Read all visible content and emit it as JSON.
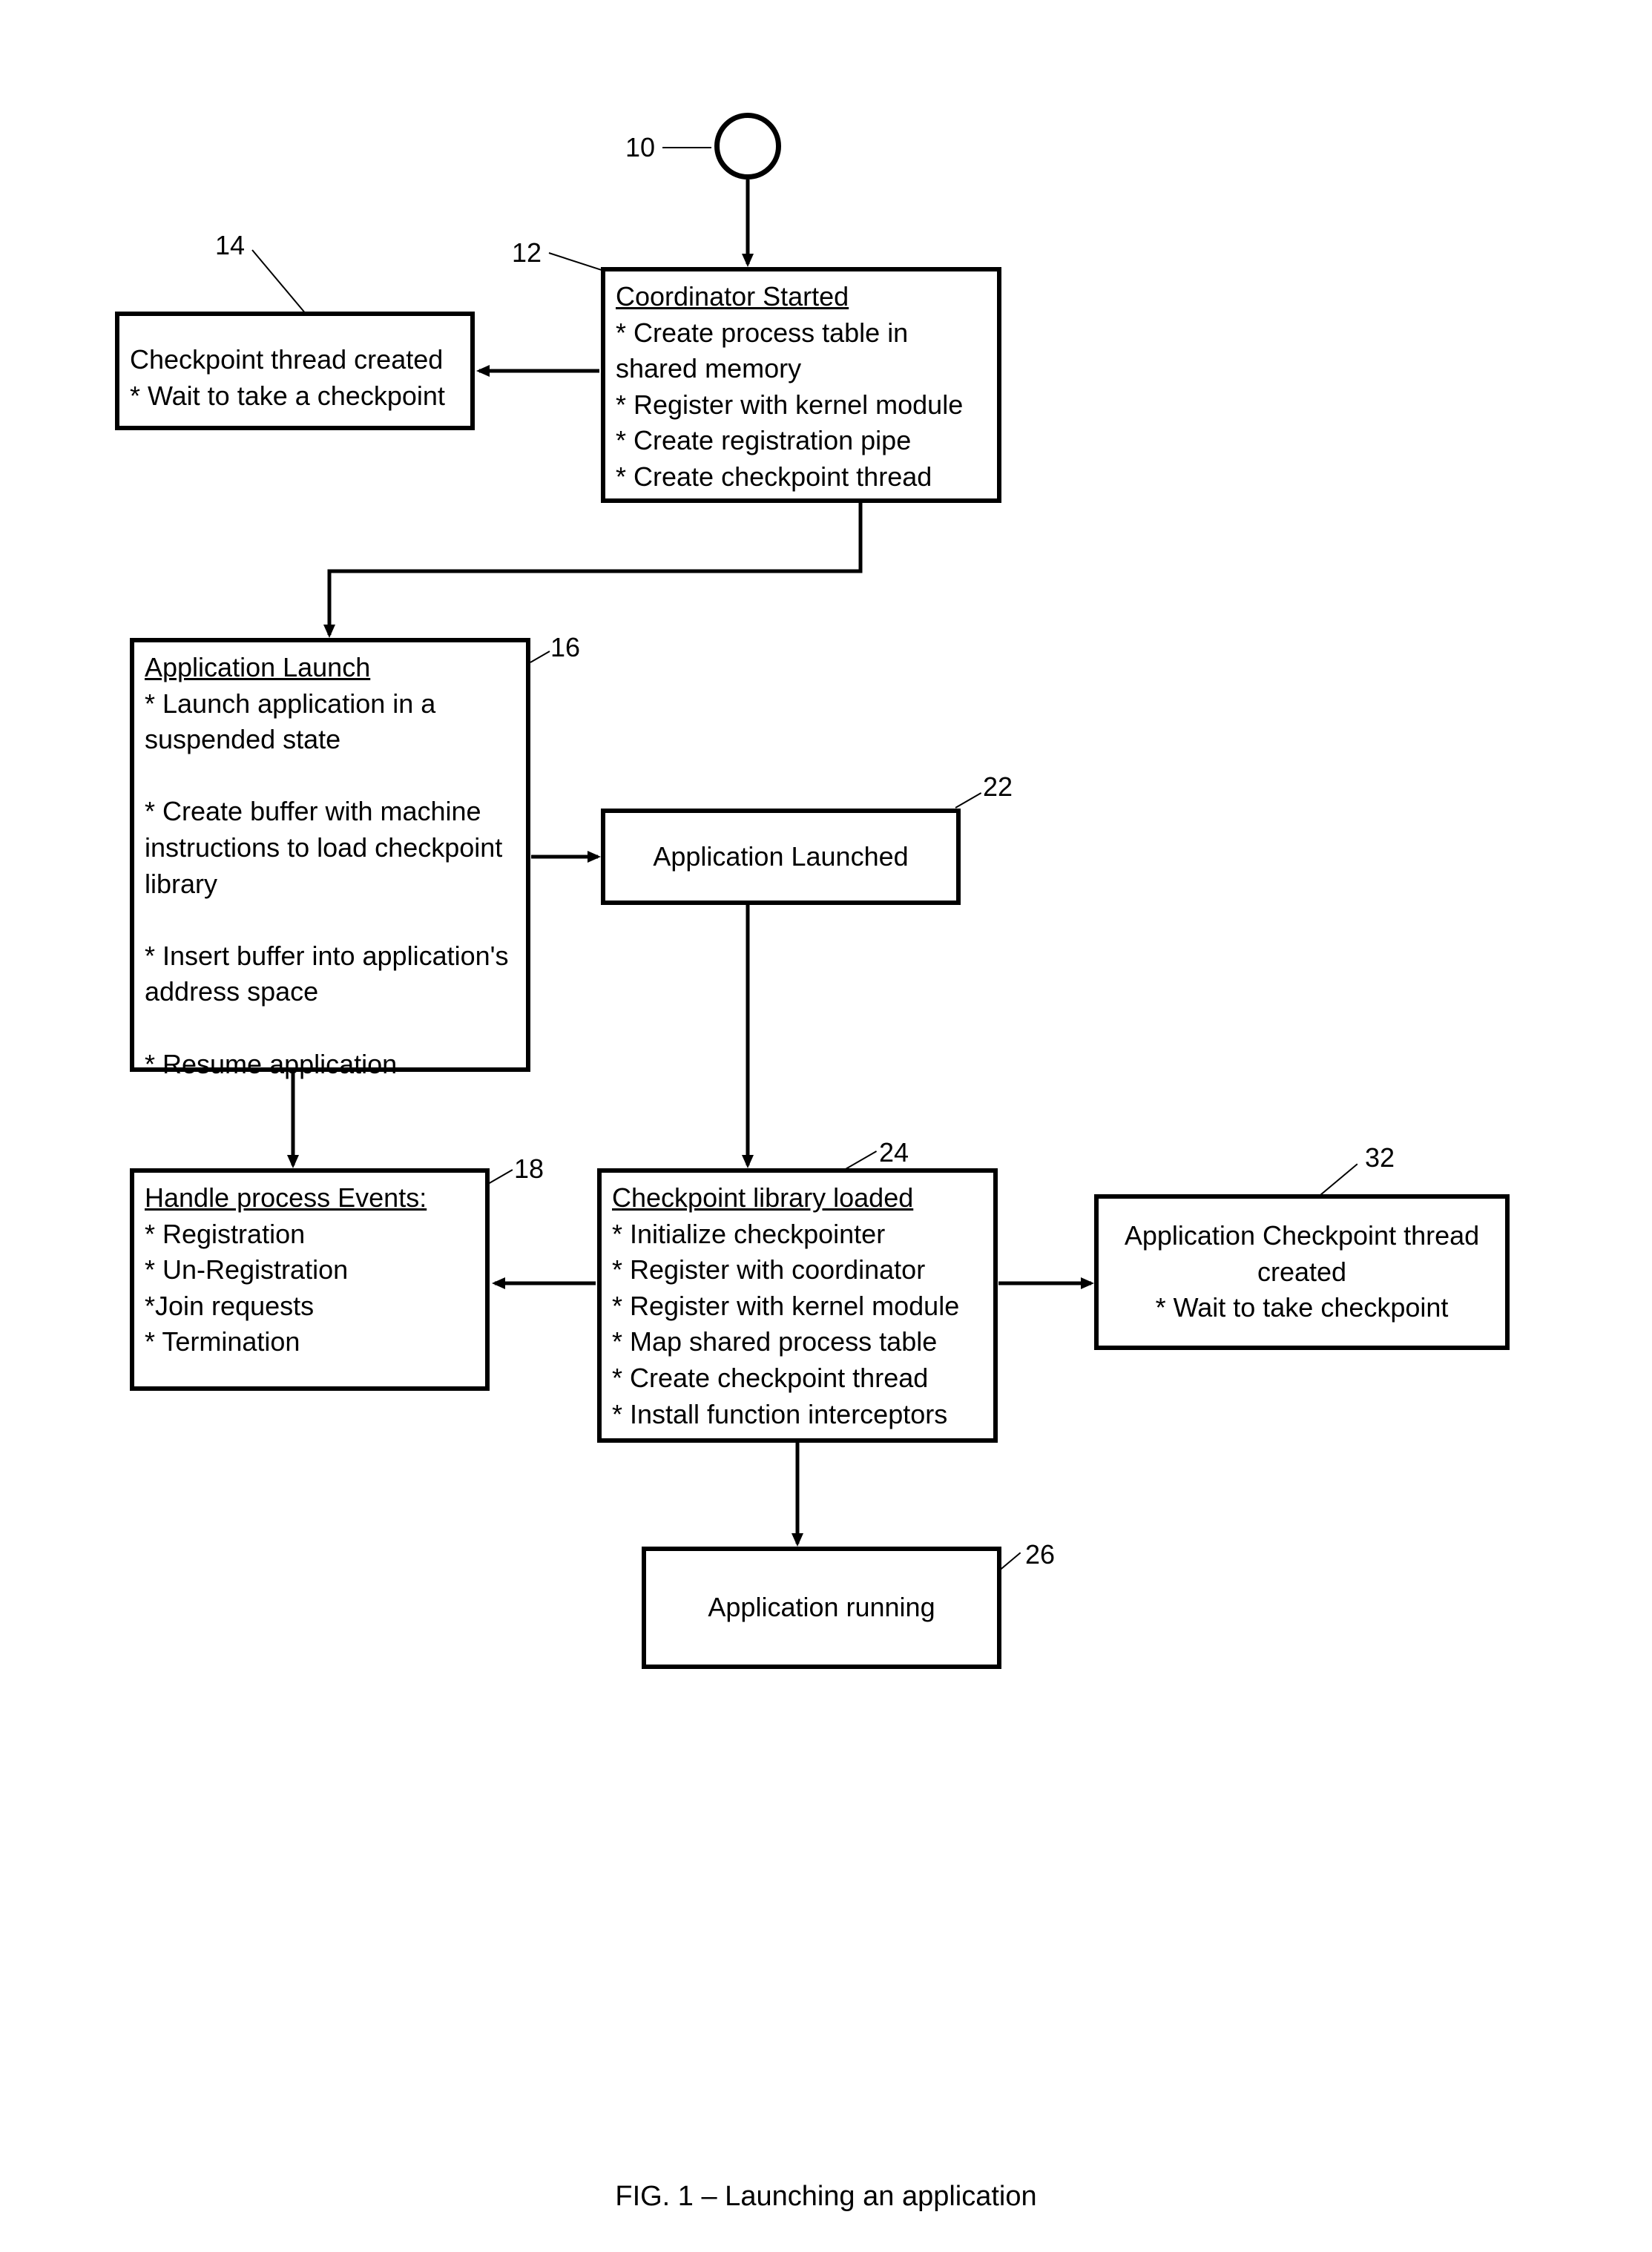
{
  "start": {
    "label_num": "10"
  },
  "coordinator": {
    "num": "12",
    "title": "Coordinator Started",
    "bullets": "* Create process table in shared memory\n* Register with kernel module\n* Create registration pipe\n* Create checkpoint thread"
  },
  "checkpoint_thread": {
    "num": "14",
    "line1": "Checkpoint thread created",
    "line2": "* Wait to take a checkpoint"
  },
  "app_launch": {
    "num": "16",
    "title": "Application Launch",
    "bullets": "* Launch application in a suspended state\n\n* Create buffer with machine instructions to load checkpoint library\n\n* Insert buffer into application's address space\n\n* Resume application"
  },
  "app_launched": {
    "num": "22",
    "text": "Application Launched"
  },
  "handle_events": {
    "num": "18",
    "title": "Handle process Events:",
    "bullets": "* Registration\n* Un-Registration\n*Join requests\n* Termination"
  },
  "ckpt_lib": {
    "num": "24",
    "title": "Checkpoint library loaded",
    "bullets": "* Initialize checkpointer\n* Register with coordinator\n* Register with kernel module\n* Map shared process table\n* Create checkpoint thread\n* Install function interceptors"
  },
  "app_ckpt_thread": {
    "num": "32",
    "line1": "Application Checkpoint thread created",
    "line2": "* Wait to take checkpoint"
  },
  "app_running": {
    "num": "26",
    "text": "Application running"
  },
  "caption": "FIG. 1 – Launching an application"
}
